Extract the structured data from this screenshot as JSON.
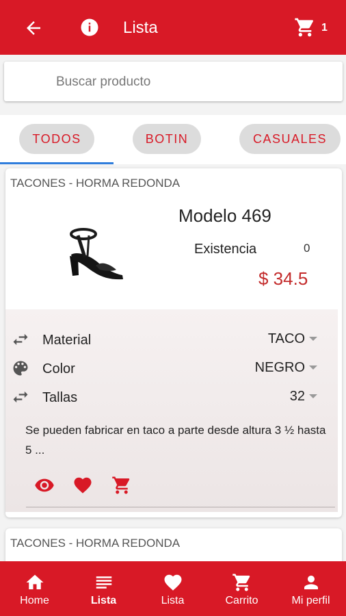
{
  "header": {
    "title": "Lista",
    "cart_count": "1"
  },
  "search": {
    "placeholder": "Buscar producto"
  },
  "tabs": [
    {
      "label": "TODOS",
      "active": true
    },
    {
      "label": "BOTIN",
      "active": false
    },
    {
      "label": "CASUALES",
      "active": false
    }
  ],
  "products": [
    {
      "category": "TACONES - HORMA REDONDA",
      "model": "Modelo 469",
      "stock_label": "Existencia",
      "stock_value": "0",
      "price": "$ 34.5",
      "options": [
        {
          "icon": "swap-icon",
          "label": "Material",
          "value": "TACO"
        },
        {
          "icon": "palette-icon",
          "label": "Color",
          "value": "NEGRO"
        },
        {
          "icon": "swap-icon",
          "label": "Tallas",
          "value": "32"
        }
      ],
      "description": "Se pueden fabricar en taco a parte desde altura 3 ½ hasta 5 ..."
    },
    {
      "category": "TACONES - HORMA REDONDA"
    }
  ],
  "bottom_nav": [
    {
      "icon": "home-icon",
      "label": "Home",
      "active": false
    },
    {
      "icon": "list-icon",
      "label": "Lista",
      "active": true
    },
    {
      "icon": "heart-icon",
      "label": "Lista",
      "active": false
    },
    {
      "icon": "cart-icon",
      "label": "Carrito",
      "active": false
    },
    {
      "icon": "person-icon",
      "label": "Mi perfil",
      "active": false
    }
  ],
  "colors": {
    "brand_red": "#d81926",
    "price_red": "#c32b2b",
    "tab_underline": "#2f7ddc"
  }
}
